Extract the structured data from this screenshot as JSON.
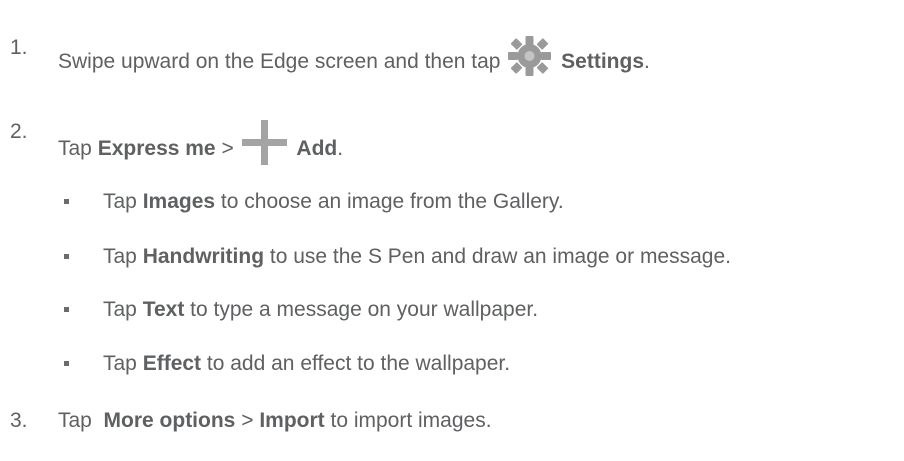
{
  "steps": [
    {
      "number": "1.",
      "pre": "Swipe upward on the Edge screen and then tap",
      "icon": "gear-icon",
      "bold": "Settings",
      "post": "."
    },
    {
      "number": "2.",
      "pre": "Tap",
      "bold1": "Express me",
      "mid": ">",
      "icon": "plus-icon",
      "bold2": "Add",
      "post": "."
    },
    {
      "number": "3.",
      "pre": "Tap",
      "bold1": "More options",
      "mid": ">",
      "bold2": "Import",
      "post": "to import images."
    }
  ],
  "subitems": [
    {
      "pre": "Tap",
      "bold": "Images",
      "post": "to choose an image from the Gallery."
    },
    {
      "pre": "Tap",
      "bold": "Handwriting",
      "post": "to use the S Pen and draw an image or message."
    },
    {
      "pre": "Tap",
      "bold": "Text",
      "post": "to type a message on your wallpaper."
    },
    {
      "pre": "Tap",
      "bold": "Effect",
      "post": "to add an effect to the wallpaper."
    }
  ],
  "colors": {
    "text": "#5f6062",
    "gear_icon": "#9a9a9a",
    "plus_icon": "#a4a4a4"
  }
}
